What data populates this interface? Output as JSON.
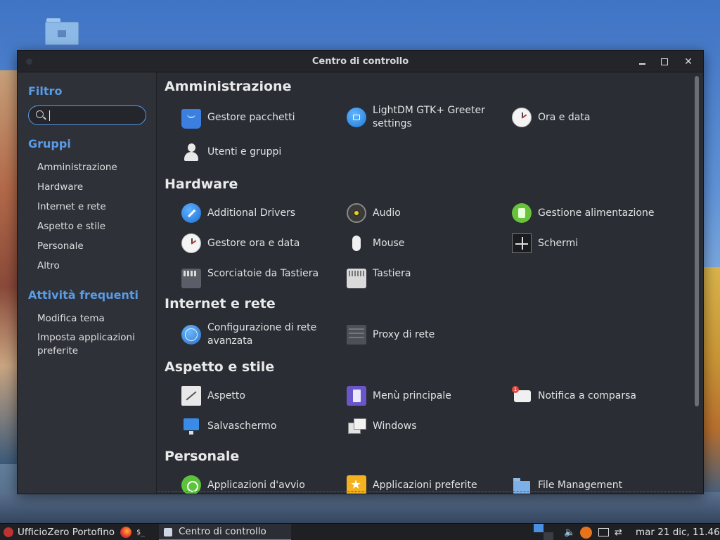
{
  "window": {
    "title": "Centro di controllo"
  },
  "sidebar": {
    "filter_heading": "Filtro",
    "search_placeholder": "",
    "groups_heading": "Gruppi",
    "groups": [
      "Amministrazione",
      "Hardware",
      "Internet e rete",
      "Aspetto e stile",
      "Personale",
      "Altro"
    ],
    "frequent_heading": "Attività frequenti",
    "frequent": [
      "Modifica tema",
      "Imposta applicazioni preferite"
    ]
  },
  "categories": [
    {
      "title": "Amministrazione",
      "items": [
        {
          "label": "Gestore pacchetti",
          "icon": "package-icon"
        },
        {
          "label": "LightDM GTK+ Greeter settings",
          "icon": "greeter-icon"
        },
        {
          "label": "Ora e data",
          "icon": "clock-icon"
        },
        {
          "label": "Utenti e gruppi",
          "icon": "user-icon"
        }
      ]
    },
    {
      "title": "Hardware",
      "items": [
        {
          "label": "Additional Drivers",
          "icon": "drivers-icon"
        },
        {
          "label": "Audio",
          "icon": "speaker-icon"
        },
        {
          "label": "Gestione alimentazione",
          "icon": "battery-icon"
        },
        {
          "label": "Gestore ora e data",
          "icon": "clock-icon"
        },
        {
          "label": "Mouse",
          "icon": "mouse-icon"
        },
        {
          "label": "Schermi",
          "icon": "display-icon"
        },
        {
          "label": "Scorciatoie da Tastiera",
          "icon": "keyboard-shortcuts-icon"
        },
        {
          "label": "Tastiera",
          "icon": "keyboard-icon"
        }
      ]
    },
    {
      "title": "Internet e rete",
      "items": [
        {
          "label": "Configurazione di rete avanzata",
          "icon": "globe-icon"
        },
        {
          "label": "Proxy di rete",
          "icon": "proxy-icon"
        }
      ]
    },
    {
      "title": "Aspetto e stile",
      "items": [
        {
          "label": "Aspetto",
          "icon": "appearance-icon"
        },
        {
          "label": "Menù principale",
          "icon": "menu-icon"
        },
        {
          "label": "Notifica a comparsa",
          "icon": "notification-icon"
        },
        {
          "label": "Salvaschermo",
          "icon": "screensaver-icon"
        },
        {
          "label": "Windows",
          "icon": "windows-icon"
        }
      ]
    },
    {
      "title": "Personale",
      "items": [
        {
          "label": "Applicazioni d'avvio",
          "icon": "power-icon"
        },
        {
          "label": "Applicazioni preferite",
          "icon": "star-icon"
        },
        {
          "label": "File Management",
          "icon": "folder-icon"
        }
      ]
    }
  ],
  "taskbar": {
    "menu_label": "UfficioZero Portofino",
    "terminal_label": "$_",
    "task_label": "Centro di controllo",
    "clock": "mar 21 dic, 11.46"
  },
  "colors": {
    "accent": "#5a9be6",
    "window_bg": "#2a2d34",
    "sidebar_bg": "#2e3138"
  }
}
